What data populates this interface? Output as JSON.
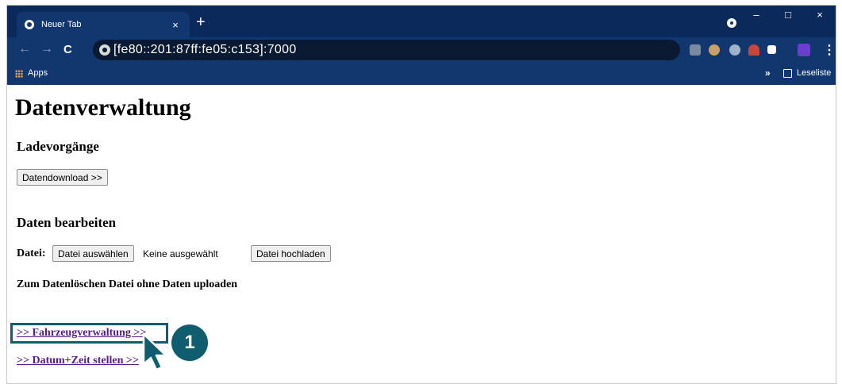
{
  "browser": {
    "tab": {
      "title": "Neuer Tab",
      "close_glyph": "×"
    },
    "new_tab_glyph": "+",
    "window_controls": {
      "minimize": "–",
      "maximize": "□",
      "close": "×"
    },
    "nav": {
      "back": "←",
      "forward": "→",
      "reload": "C"
    },
    "address": "[fe80::201:87ff:fe05:c153]:7000",
    "extensions": [
      "extension-icon",
      "cookie-icon",
      "bug-icon",
      "alien-icon",
      "puzzle-icon",
      "profile-icon"
    ],
    "menu_glyph": "⋮",
    "bookmarks": {
      "apps_label": "Apps",
      "overflow_glyph": "»",
      "reading_list_label": "Leseliste"
    },
    "colors": {
      "titlebar": "#0b2a5b",
      "toolbar": "#12376f",
      "omnibox": "#0a1a33"
    }
  },
  "page": {
    "title": "Datenverwaltung",
    "section_loading": {
      "heading": "Ladevorgänge",
      "download_button": "Datendownload >>"
    },
    "section_edit": {
      "heading": "Daten bearbeiten",
      "file_label": "Datei:",
      "choose_button": "Datei auswählen",
      "no_file_text": "Keine ausgewählt",
      "upload_button": "Datei hochladen",
      "note": "Zum Datenlöschen Datei ohne Daten uploaden"
    },
    "links": {
      "vehicle_admin": ">> Fahrzeugverwaltung >>",
      "datetime": ">> Datum+Zeit stellen >>"
    }
  },
  "annotation": {
    "step_number": "1",
    "highlight_color": "#0f5d6e"
  }
}
